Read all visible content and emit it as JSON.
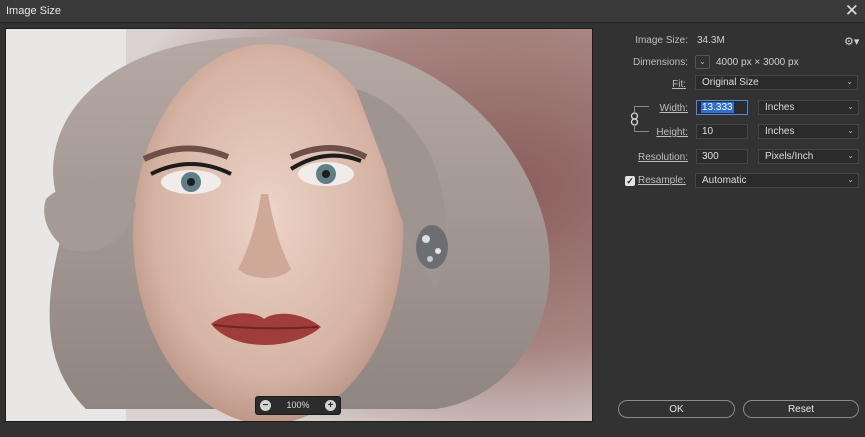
{
  "window": {
    "title": "Image Size",
    "close": "✕"
  },
  "preview": {
    "zoom": "100%",
    "zoom_out": "−",
    "zoom_in": "+"
  },
  "info": {
    "image_size_label": "Image Size:",
    "image_size_value": "34.3M",
    "dimensions_label": "Dimensions:",
    "dimensions_value": "4000 px  ×  3000 px"
  },
  "fit": {
    "label": "Fit:",
    "value": "Original Size"
  },
  "width": {
    "label": "Width:",
    "value": "13.333",
    "unit": "Inches"
  },
  "height": {
    "label": "Height:",
    "value": "10",
    "unit": "Inches"
  },
  "resolution": {
    "label": "Resolution:",
    "value": "300",
    "unit": "Pixels/Inch"
  },
  "resample": {
    "label": "Resample:",
    "checked": true,
    "value": "Automatic"
  },
  "buttons": {
    "ok": "OK",
    "reset": "Reset"
  },
  "icons": {
    "gear": "gear-icon",
    "chain_link": "link-icon",
    "chevron": "chevron-down-icon"
  },
  "colors": {
    "background": "#323232",
    "selection": "#2f6fd1"
  }
}
